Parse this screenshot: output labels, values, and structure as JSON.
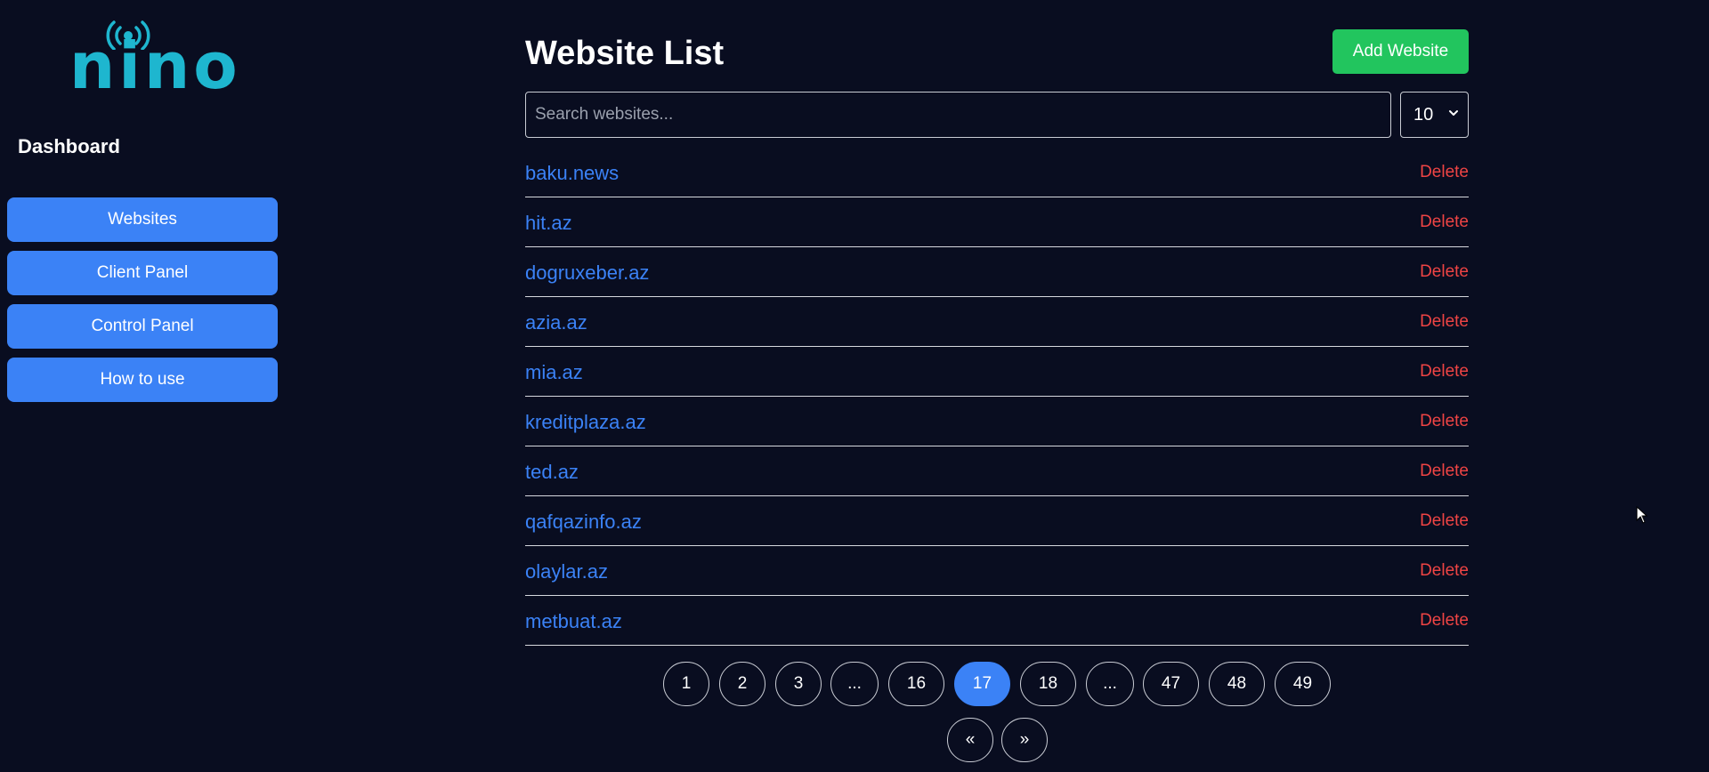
{
  "brand": {
    "name": "nino",
    "logo_color": "#1eb6cf",
    "icon": "signal-broadcast-icon"
  },
  "sidebar": {
    "title": "Dashboard",
    "items": [
      {
        "label": "Websites"
      },
      {
        "label": "Client Panel"
      },
      {
        "label": "Control Panel"
      },
      {
        "label": "How to use"
      }
    ]
  },
  "main": {
    "title": "Website List",
    "add_button": "Add Website",
    "search_placeholder": "Search websites...",
    "search_value": "",
    "page_size": "10",
    "sites": [
      {
        "name": "baku.news",
        "action": "Delete"
      },
      {
        "name": "hit.az",
        "action": "Delete"
      },
      {
        "name": "dogruxeber.az",
        "action": "Delete"
      },
      {
        "name": "azia.az",
        "action": "Delete"
      },
      {
        "name": "mia.az",
        "action": "Delete"
      },
      {
        "name": "kreditplaza.az",
        "action": "Delete"
      },
      {
        "name": "ted.az",
        "action": "Delete"
      },
      {
        "name": "qafqazinfo.az",
        "action": "Delete"
      },
      {
        "name": "olaylar.az",
        "action": "Delete"
      },
      {
        "name": "metbuat.az",
        "action": "Delete"
      }
    ],
    "pagination": {
      "pages": [
        "1",
        "2",
        "3",
        "...",
        "16",
        "17",
        "18",
        "...",
        "47",
        "48",
        "49"
      ],
      "current": "17",
      "prev": "«",
      "next": "»"
    }
  },
  "colors": {
    "background": "#090d20",
    "primary": "#3b82f6",
    "success": "#22c55e",
    "danger": "#ef4444"
  }
}
